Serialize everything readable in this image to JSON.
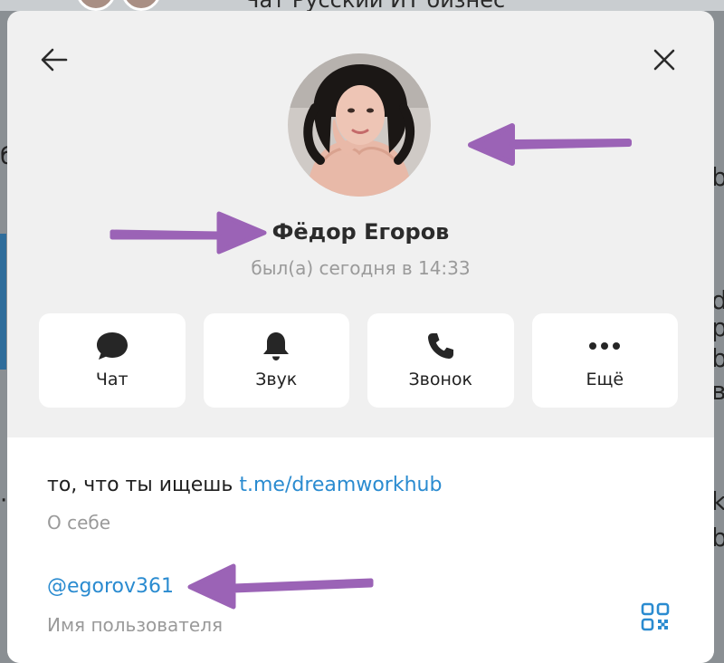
{
  "background": {
    "chat_title": "Чат Русский ИТ бизнес"
  },
  "header": {
    "back_icon": "arrow-left-icon",
    "close_icon": "close-icon"
  },
  "profile": {
    "name": "Фёдор Егоров",
    "status": "был(а) сегодня в 14:33",
    "avatar": "profile-photo"
  },
  "actions": [
    {
      "label": "Чат",
      "icon": "chat-bubble-icon"
    },
    {
      "label": "Звук",
      "icon": "bell-icon"
    },
    {
      "label": "Звонок",
      "icon": "phone-icon"
    },
    {
      "label": "Ещё",
      "icon": "more-dots-icon"
    }
  ],
  "info": {
    "about_text": "то, что ты ищешь ",
    "about_link": "t.me/dreamworkhub",
    "about_caption": "О себе",
    "username": "@egorov361",
    "username_caption": "Имя пользователя",
    "qr_icon": "qr-code-icon"
  },
  "colors": {
    "accent": "#2a8bd0",
    "annotation_arrow": "#9b63b6",
    "modal_bg": "#f0f0f0",
    "muted_text": "#9a9a9a"
  }
}
